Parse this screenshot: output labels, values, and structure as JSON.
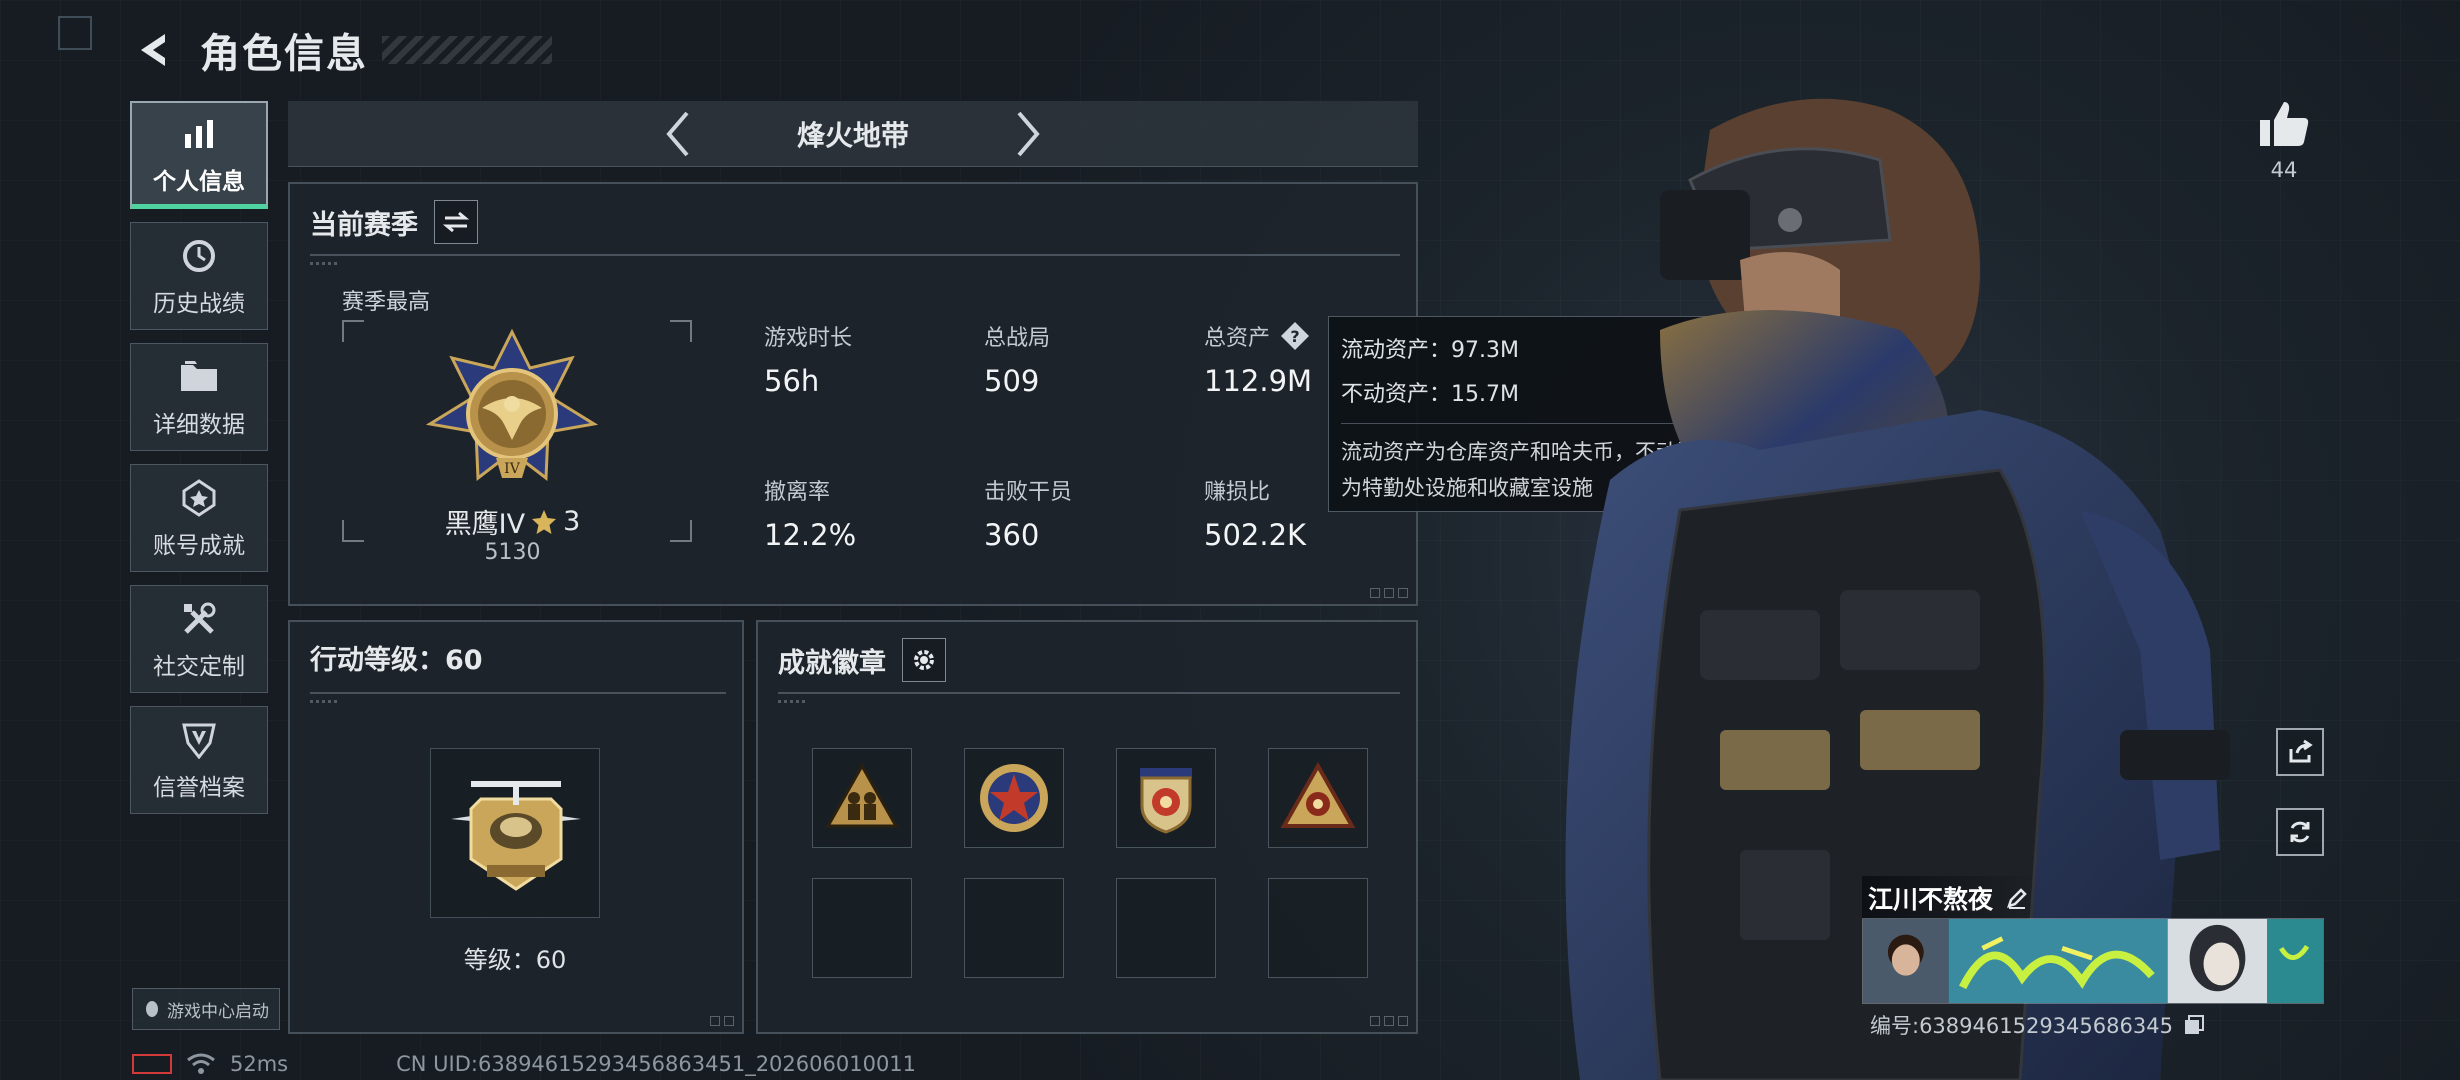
{
  "header": {
    "title": "角色信息"
  },
  "nav": {
    "items": [
      {
        "label": "个人信息",
        "icon": "bar-chart-icon",
        "active": true
      },
      {
        "label": "历史战绩",
        "icon": "history-clock-icon",
        "active": false
      },
      {
        "label": "详细数据",
        "icon": "folder-icon",
        "active": false
      },
      {
        "label": "账号成就",
        "icon": "achievement-star-icon",
        "active": false
      },
      {
        "label": "社交定制",
        "icon": "tools-icon",
        "active": false
      },
      {
        "label": "信誉档案",
        "icon": "credit-shield-icon",
        "active": false
      }
    ],
    "game_center": "游戏中心启动"
  },
  "mode": {
    "title": "烽火地带"
  },
  "season": {
    "title": "当前赛季",
    "best_label": "赛季最高",
    "rank_name": "黑鹰IV",
    "rank_stars": "3",
    "rank_points": "5130",
    "stats": [
      {
        "label": "游戏时长",
        "value": "56h"
      },
      {
        "label": "总战局",
        "value": "509"
      },
      {
        "label": "总资产",
        "value": "112.9M",
        "has_help": true
      },
      {
        "label": "撤离率",
        "value": "12.2%"
      },
      {
        "label": "击败干员",
        "value": "360"
      },
      {
        "label": "赚损比",
        "value": "502.2K"
      }
    ]
  },
  "tooltip": {
    "liquid": "流动资产：97.3M",
    "fixed": "不动资产：15.7M",
    "desc_line1": "流动资产为仓库资产和哈夫币，不动资产",
    "desc_line2": "为特勤处设施和收藏室设施"
  },
  "level": {
    "title": "行动等级：60",
    "caption": "等级：60"
  },
  "badges": {
    "title": "成就徽章",
    "slots": [
      "soldiers-badge-icon",
      "star-medal-icon",
      "shield-crest-icon",
      "triangle-emblem-icon",
      "",
      "",
      "",
      ""
    ]
  },
  "player": {
    "likes": "44",
    "name": "江川不熬夜",
    "id_text": "编号:6389461529345686345"
  },
  "status": {
    "ping": "52ms",
    "uid": "CN UID:638946152934568634​51_202606010011"
  },
  "colors": {
    "accent_green": "#4fd3a0",
    "panel_bg": "#1e252c",
    "battery_red": "#d23a3a"
  }
}
